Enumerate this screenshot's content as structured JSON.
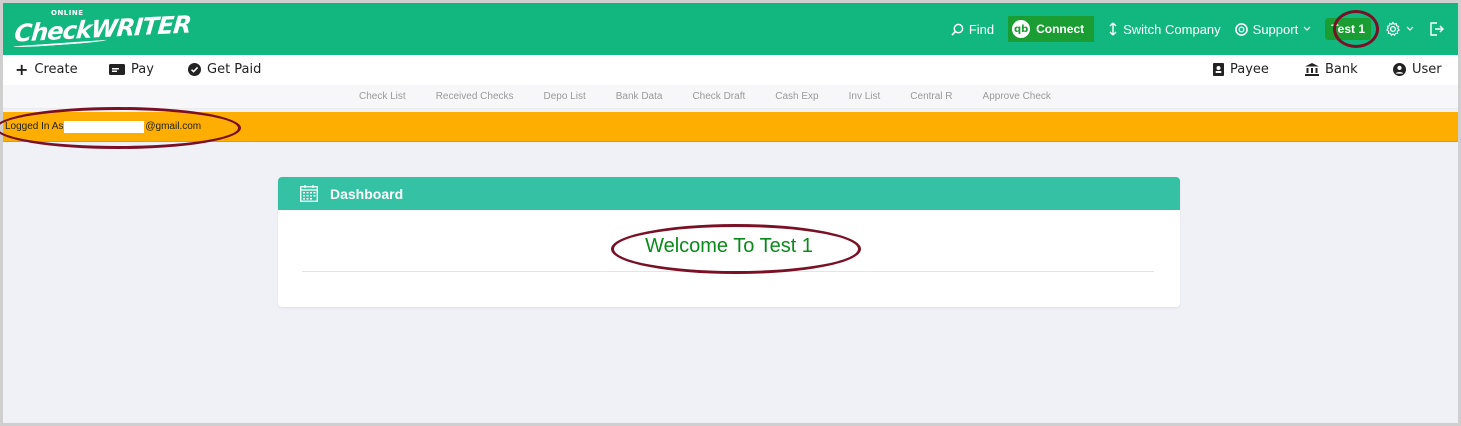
{
  "header": {
    "logo_online": "ONLINE",
    "logo_brand": "CheckWRITER",
    "find_label": "Find",
    "connect_label": "Connect",
    "switch_company_label": "Switch Company",
    "support_label": "Support",
    "user_label": "Test 1"
  },
  "actions": {
    "create": "Create",
    "pay": "Pay",
    "get_paid": "Get Paid",
    "payee": "Payee",
    "bank": "Bank",
    "user": "User"
  },
  "subnav": [
    "Check List",
    "Received Checks",
    "Depo List",
    "Bank Data",
    "Check Draft",
    "Cash Exp",
    "Inv List",
    "Central R",
    "Approve Check"
  ],
  "logged_in": {
    "prefix": "Logged In As",
    "suffix": "@gmail.com"
  },
  "dashboard": {
    "title": "Dashboard",
    "welcome": "Welcome To Test 1"
  },
  "colors": {
    "header_bg": "#12b77f",
    "connect_bg": "#1a9e34",
    "banner_bg": "#fdae00",
    "card_head_bg": "#35c1a3",
    "welcome_text": "#0a8a1a",
    "annotation": "#7a1025"
  }
}
